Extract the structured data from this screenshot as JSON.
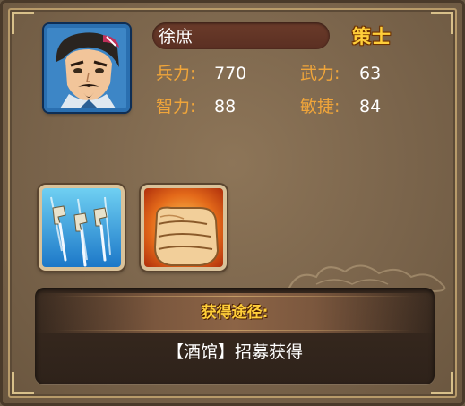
{
  "general": {
    "name": "徐庶",
    "class": "策士"
  },
  "stats": {
    "troops_label": "兵力:",
    "troops_value": "770",
    "force_label": "武力:",
    "force_value": "63",
    "intelligence_label": "智力:",
    "intelligence_value": "88",
    "agility_label": "敏捷:",
    "agility_value": "84"
  },
  "skills": [
    {
      "icon": "flying-swords-icon"
    },
    {
      "icon": "fist-icon"
    }
  ],
  "acquisition": {
    "title": "获得途径:",
    "content": "【酒馆】招募获得"
  },
  "colors": {
    "accent_gold": "#ffcf3a",
    "stat_label": "#f0a53a",
    "portrait_frame": "#2a6fb0"
  }
}
